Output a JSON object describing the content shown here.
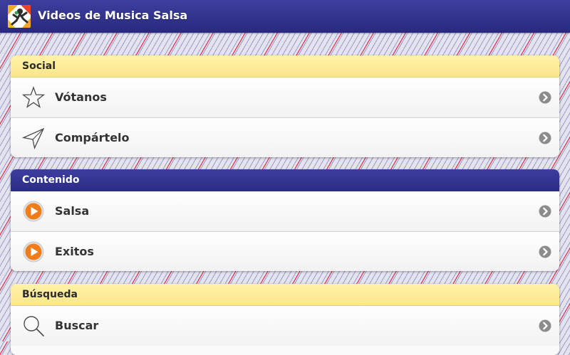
{
  "app": {
    "title": "Videos de Musica Salsa",
    "app_icon": "salsa-dancer-icon"
  },
  "colors": {
    "titlebar": "#2e3090",
    "section_yellow": "#fbe68c",
    "section_blue": "#2e3090",
    "play_orange": "#f07d1a",
    "background_stripe_red": "#e03a5a",
    "background_stripe_blue": "#9a9acb"
  },
  "sections": [
    {
      "header": "Social",
      "style": "yellow",
      "items": [
        {
          "label": "Vótanos",
          "icon": "star-icon"
        },
        {
          "label": "Compártelo",
          "icon": "share-arrow-icon"
        }
      ]
    },
    {
      "header": "Contenido",
      "style": "blue",
      "items": [
        {
          "label": "Salsa",
          "icon": "play-icon"
        },
        {
          "label": "Exitos",
          "icon": "play-icon"
        }
      ]
    },
    {
      "header": "Búsqueda",
      "style": "yellow",
      "items": [
        {
          "label": "Buscar",
          "icon": "search-icon"
        }
      ]
    }
  ]
}
